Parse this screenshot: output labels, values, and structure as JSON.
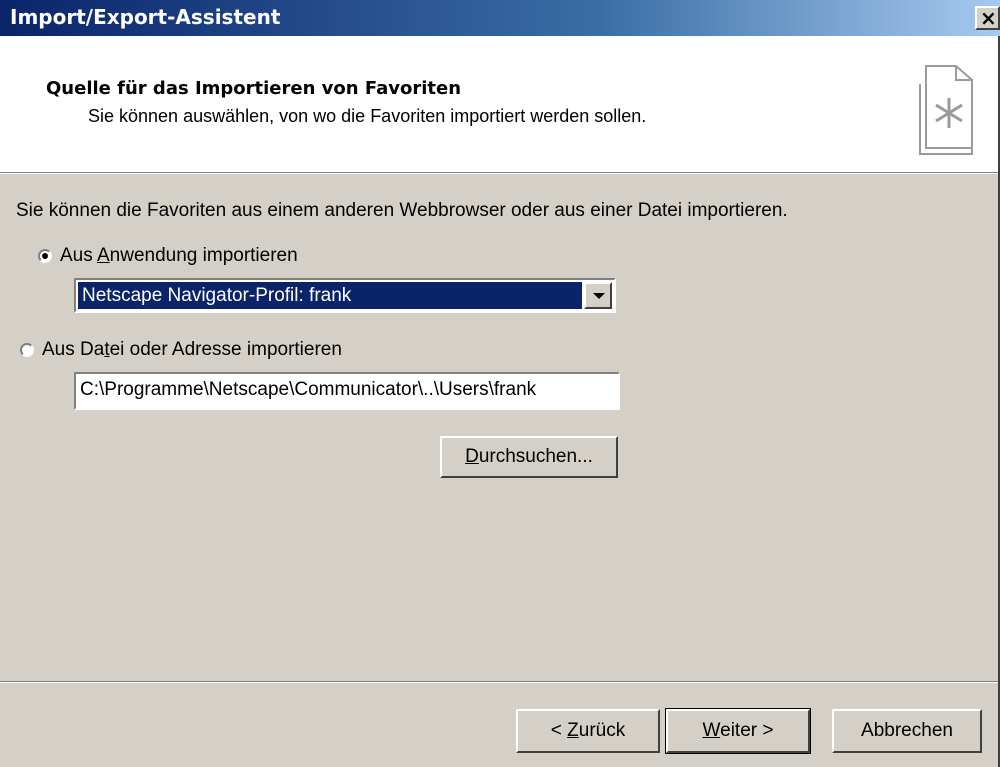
{
  "window": {
    "title": "Import/Export-Assistent",
    "close_symbol": "×"
  },
  "header": {
    "title": "Quelle für das Importieren von Favoriten",
    "subtitle": "Sie können auswählen, von wo die Favoriten importiert werden sollen.",
    "icon": "wizard-page-icon"
  },
  "body": {
    "description": "Sie können die Favoriten aus einem anderen Webbrowser oder aus einer Datei importieren.",
    "option_app": {
      "pre": "Aus ",
      "accel": "A",
      "post": "nwendung importieren",
      "selected": true
    },
    "app_combo": {
      "value": "Netscape Navigator-Profil: frank"
    },
    "option_file": {
      "pre": "Aus Da",
      "accel": "t",
      "post": "ei oder Adresse importieren",
      "selected": false
    },
    "file_path": {
      "value": "C:\\Programme\\Netscape\\Communicator\\..\\Users\\frank"
    },
    "browse": {
      "accel": "D",
      "post": "urchsuchen..."
    }
  },
  "footer": {
    "back": {
      "pre": "< ",
      "accel": "Z",
      "post": "urück"
    },
    "next": {
      "accel": "W",
      "post": "eiter >"
    },
    "cancel": {
      "label": "Abbrechen"
    }
  }
}
